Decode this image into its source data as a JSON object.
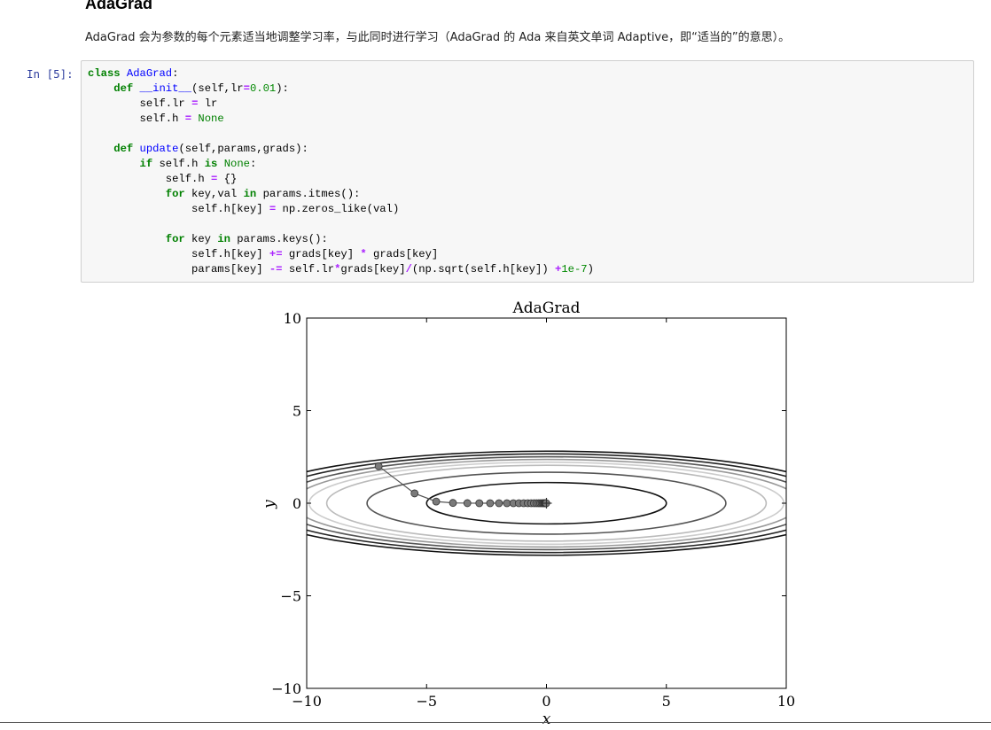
{
  "section": {
    "heading": "AdaGrad",
    "description": "AdaGrad 会为参数的每个元素适当地调整学习率，与此同时进行学习（AdaGrad 的 Ada 来自英文单词 Adaptive，即“适当的”的意思）。"
  },
  "cell": {
    "prompt": "In  [5]:",
    "code_lines": [
      "class AdaGrad:",
      "    def __init__(self,lr=0.01):",
      "        self.lr = lr",
      "        self.h = None",
      "",
      "    def update(self,params,grads):",
      "        if self.h is None:",
      "            self.h = {}",
      "            for key,val in params.itmes():",
      "                self.h[key] = np.zeros_like(val)",
      "",
      "            for key in params.keys():",
      "                self.h[key] += grads[key] * grads[key]",
      "                params[key] -= self.lr*grads[key]/(np.sqrt(self.h[key]) +1e-7)"
    ]
  },
  "chart_data": {
    "type": "contour+line",
    "title": "AdaGrad",
    "xlabel": "x",
    "ylabel": "y",
    "xlim": [
      -10,
      10
    ],
    "ylim": [
      -10,
      10
    ],
    "xticks": [
      "−10",
      "−5",
      "0",
      "5",
      "10"
    ],
    "yticks": [
      "−10",
      "−5",
      "0",
      "5",
      "10"
    ],
    "function": "f(x,y) = x^2/20 + y^2",
    "contour_levels": [
      {
        "level": 1.25,
        "color": "#111111"
      },
      {
        "level": 2.8,
        "color": "#555555"
      },
      {
        "level": 4.2,
        "color": "#bbbbbb"
      },
      {
        "level": 4.9,
        "color": "#cccccc"
      },
      {
        "level": 5.6,
        "color": "#999999"
      },
      {
        "level": 6.3,
        "color": "#555555"
      },
      {
        "level": 7.1,
        "color": "#222222"
      },
      {
        "level": 7.9,
        "color": "#111111"
      }
    ],
    "path": {
      "name": "AdaGrad",
      "x": [
        -7.0,
        -5.5,
        -4.6,
        -3.9,
        -3.3,
        -2.8,
        -2.35,
        -1.98,
        -1.65,
        -1.38,
        -1.15,
        -0.95,
        -0.78,
        -0.64,
        -0.52,
        -0.42,
        -0.33,
        -0.26,
        -0.2,
        -0.15,
        -0.11,
        -0.08,
        -0.05,
        -0.03,
        -0.01
      ],
      "y": [
        2.0,
        0.53,
        0.09,
        0.015,
        0.003,
        0.0,
        0.0,
        0.0,
        0.0,
        0.0,
        0.0,
        0.0,
        0.0,
        0.0,
        0.0,
        0.0,
        0.0,
        0.0,
        0.0,
        0.0,
        0.0,
        0.0,
        0.0,
        0.0,
        0.0
      ],
      "marker_color": "#7a7a7a",
      "line_color": "#555555"
    },
    "minimum_marker": {
      "x": 0,
      "y": 0,
      "symbol": "+"
    }
  }
}
